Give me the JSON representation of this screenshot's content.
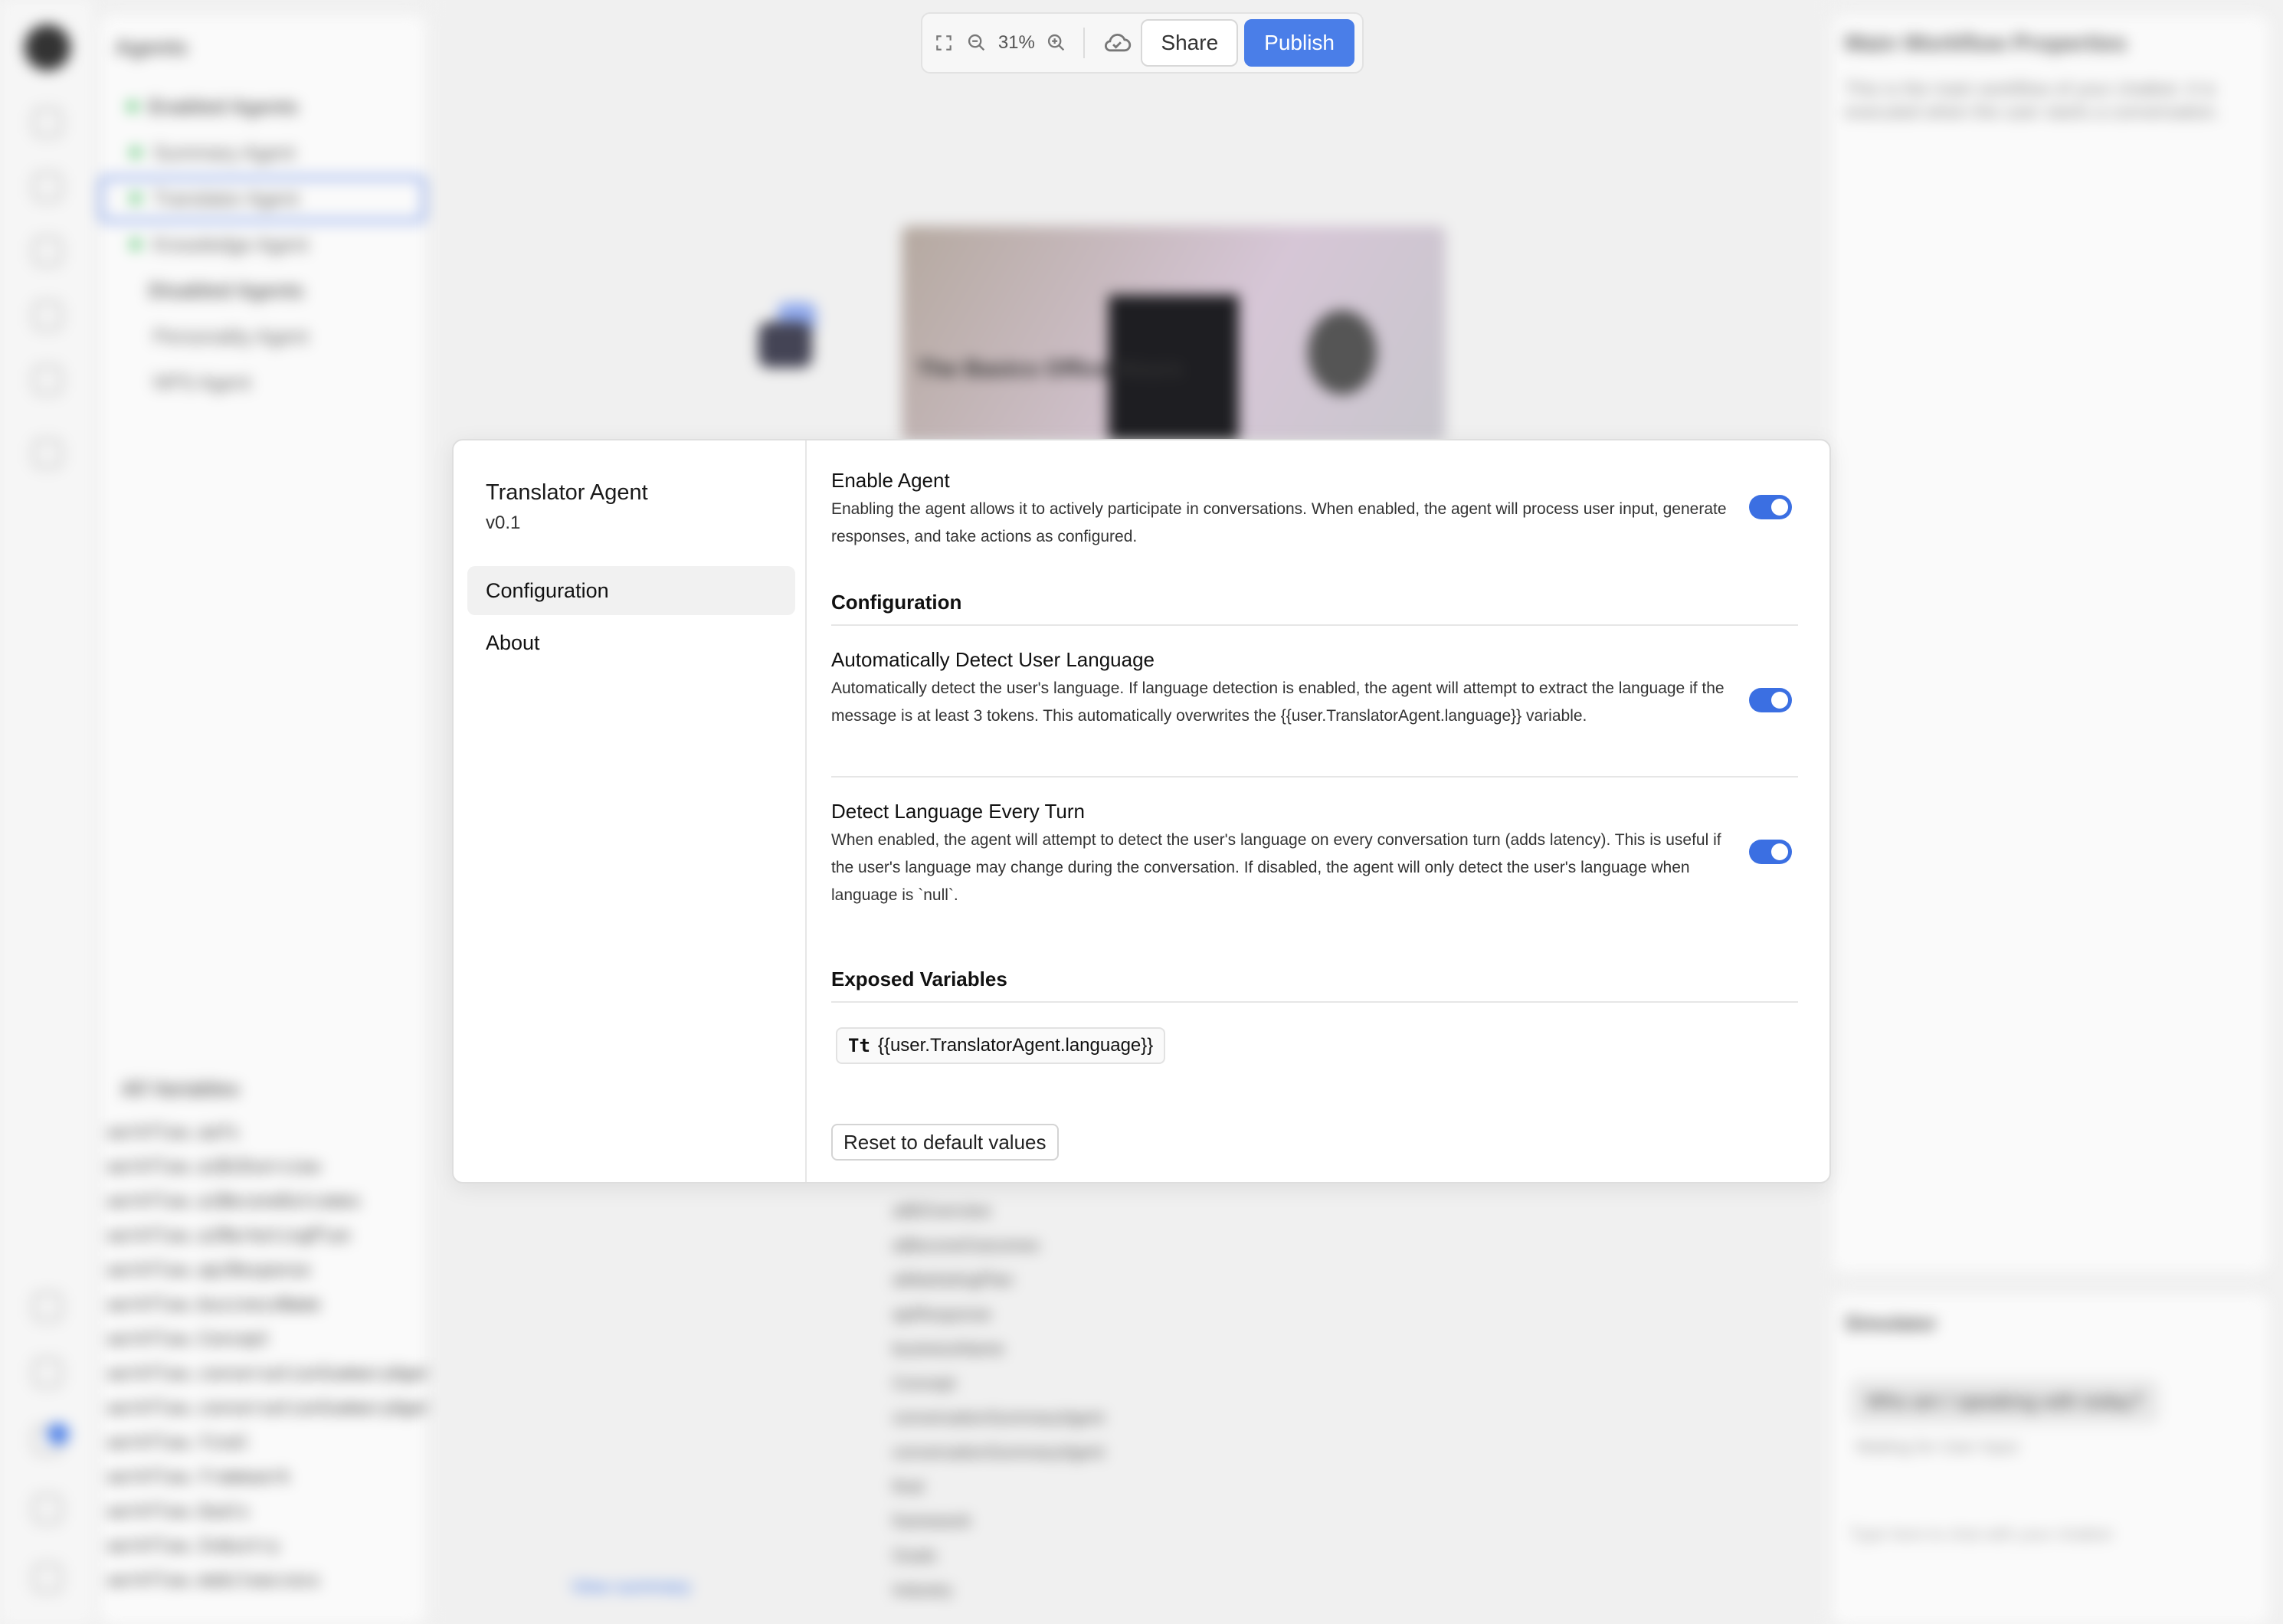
{
  "toolbar": {
    "zoom": "31%",
    "share_label": "Share",
    "publish_label": "Publish",
    "accent_color": "#4a7ee8"
  },
  "background": {
    "left_panel_title": "Agents",
    "enabled_group": "Enabled Agents",
    "enabled_agents": [
      "Summary Agent",
      "Translator Agent",
      "Knowledge Agent"
    ],
    "disabled_group": "Disabled Agents",
    "disabled_agents": [
      "Personality Agent",
      "NPS Agent"
    ],
    "variables_filter": "All Variables",
    "variables": [
      "workflow.aafs",
      "workflow.aiBiOverview",
      "workflow.aiBeconeOutcomes",
      "workflow.aiMarketingPlan",
      "workflow.apiResponse",
      "workflow.businessName",
      "workflow.Concept",
      "workflow.conversationSummaryAgent",
      "workflow.conversationSummaryAgent",
      "workflow.final",
      "workflow.framework",
      "workflow.Goals",
      "workflow.Industry",
      "workflow.mobileaccess"
    ],
    "canvas_rows": [
      "aiBiOverview",
      "aiBeconeOutcomes",
      "aiMarketingPlan",
      "apiResponse",
      "businessName",
      "Concept",
      "conversationSummaryAgent",
      "conversationSummaryAgent",
      "final",
      "framework",
      "Goals",
      "Industry"
    ],
    "view_summary": "View summary",
    "video_title": "The Basics Office Hours",
    "right_panel_title": "Main Workflow Properties",
    "right_panel_desc": "This is the main workflow of your chatbot. It is executed when the user starts a conversation.",
    "simulator_title": "Simulator",
    "simulator_bubble": "Who am I speaking with today?",
    "simulator_wait": "Waiting for User Input",
    "simulator_input_placeholder": "Type here to chat with your chatbot"
  },
  "modal": {
    "agent_name": "Translator Agent",
    "agent_version": "v0.1",
    "nav": [
      {
        "label": "Configuration",
        "active": true
      },
      {
        "label": "About",
        "active": false
      }
    ],
    "enable": {
      "title": "Enable Agent",
      "description": "Enabling the agent allows it to actively participate in conversations. When enabled, the agent will process user input, generate responses, and take actions as configured.",
      "on": true
    },
    "config_title": "Configuration",
    "auto_detect": {
      "title": "Automatically Detect User Language",
      "description": "Automatically detect the user's language. If language detection is enabled, the agent will attempt to extract the language if the message is at least 3 tokens. This automatically overwrites the {{user.TranslatorAgent.language}} variable.",
      "on": true
    },
    "every_turn": {
      "title": "Detect Language Every Turn",
      "description": "When enabled, the agent will attempt to detect the user's language on every conversation turn (adds latency). This is useful if the user's language may change during the conversation. If disabled, the agent will only detect the user's language when language is `null`.",
      "on": true
    },
    "exposed_title": "Exposed Variables",
    "variable_type_icon": "Tt",
    "variable": "{{user.TranslatorAgent.language}}",
    "reset_label": "Reset to default values"
  }
}
